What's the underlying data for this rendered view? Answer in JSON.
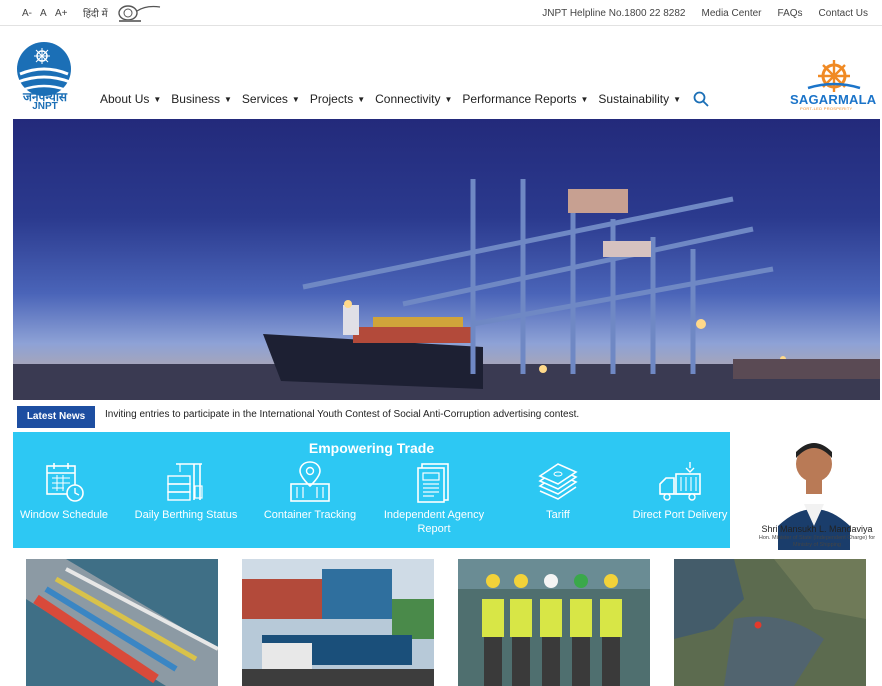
{
  "topbar": {
    "font_controls": [
      "A-",
      "A",
      "A+"
    ],
    "language": "हिंदी में",
    "links": [
      "JNPT Helpline No.1800 22 8282",
      "Media Center",
      "FAQs",
      "Contact Us"
    ]
  },
  "header": {
    "logo_hindi": "जनेपन्यास",
    "logo_english": "JNPT",
    "nav": [
      "About Us",
      "Business",
      "Services",
      "Projects",
      "Connectivity",
      "Performance Reports",
      "Sustainability"
    ],
    "partner_logo": "SAGARMALA",
    "partner_tagline": "PORT-LED PROSPERITY"
  },
  "news": {
    "badge": "Latest News",
    "text": "Inviting entries to participate in the International Youth Contest of Social Anti-Corruption advertising contest."
  },
  "trade": {
    "title": "Empowering Trade",
    "services": [
      {
        "label": "Window Schedule",
        "icon": "calendar-clock-icon"
      },
      {
        "label": "Daily Berthing Status",
        "icon": "crane-containers-icon"
      },
      {
        "label": "Container Tracking",
        "icon": "container-location-icon"
      },
      {
        "label": "Independent Agency Report",
        "icon": "report-document-icon"
      },
      {
        "label": "Tariff",
        "icon": "money-stack-icon"
      },
      {
        "label": "Direct Port Delivery",
        "icon": "truck-container-icon"
      }
    ]
  },
  "minister": {
    "name": "Shri Mansukh L. Mandaviya",
    "title": "Hon. Minister of State (Independent Charge) for Ministry of Shipping"
  },
  "colors": {
    "accent": "#2dc8f3",
    "news_badge": "#1d4ea1",
    "brand_blue": "#1b6fb6",
    "sagarmala_orange": "#f08a24"
  }
}
